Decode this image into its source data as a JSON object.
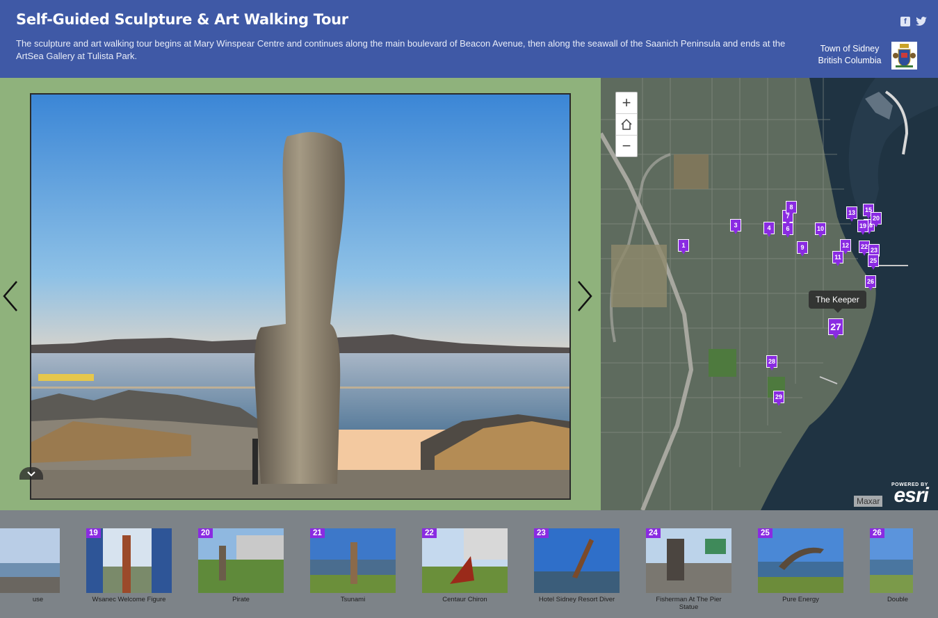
{
  "header": {
    "title": "Self-Guided Sculpture & Art Walking Tour",
    "subtitle": "The sculpture and art walking tour begins at Mary Winspear Centre and continues along the main boulevard of Beacon Avenue, then along the seawall of the Saanich Peninsula and ends at the ArtSea Gallery at Tulista Park.",
    "org_line1": "Town of Sidney",
    "org_line2": "British Columbia",
    "facebook_glyph": "f",
    "twitter_glyph": "🐦"
  },
  "colors": {
    "header_bg": "#3f59a6",
    "media_bg": "#8fb27c",
    "carousel_bg": "#7d8388",
    "accent_pin": "#8a2be2"
  },
  "map": {
    "zoom_in": "+",
    "zoom_out": "−",
    "tooltip": "The Keeper",
    "attribution": "Maxar",
    "powered_by": "POWERED BY",
    "esri": "esri",
    "pins": [
      "1",
      "3",
      "4",
      "6",
      "7",
      "8",
      "9",
      "10",
      "11",
      "12",
      "13",
      "15",
      "16",
      "19",
      "20",
      "22",
      "23",
      "25",
      "26",
      "27",
      "28",
      "29"
    ]
  },
  "carousel": {
    "items": [
      {
        "num": "",
        "caption": "use"
      },
      {
        "num": "19",
        "caption": "Wsanec Welcome Figure"
      },
      {
        "num": "20",
        "caption": "Pirate"
      },
      {
        "num": "21",
        "caption": "Tsunami"
      },
      {
        "num": "22",
        "caption": "Centaur Chiron"
      },
      {
        "num": "23",
        "caption": "Hotel Sidney Resort Diver"
      },
      {
        "num": "24",
        "caption": "Fisherman At The Pier Statue"
      },
      {
        "num": "25",
        "caption": "Pure Energy"
      },
      {
        "num": "26",
        "caption": "Double"
      }
    ]
  }
}
